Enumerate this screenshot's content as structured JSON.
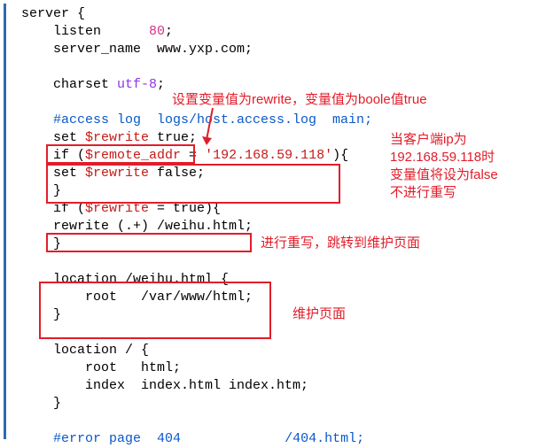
{
  "code": {
    "l1a": "server {",
    "l2a": "    listen      ",
    "l2b": "80",
    "l2c": ";",
    "l3a": "    server_name  www.yxp.com;",
    "l5a": "    charset ",
    "l5b": "utf-8",
    "l5c": ";",
    "l7a": "    #access log  logs/host.access.log  main;",
    "l8a": "    set ",
    "l8b": "$rewrite",
    "l8c": " true;",
    "l9a": "    if (",
    "l9b": "$remote_addr",
    "l9c": " = ",
    "l9d": "'192.168.59.118'",
    "l9e": "){",
    "l10a": "    set ",
    "l10b": "$rewrite",
    "l10c": " false;",
    "l11a": "    }",
    "l12a": "    if (",
    "l12b": "$rewrite",
    "l12c": " = true){",
    "l13a": "    rewrite (.+) /weihu.html;",
    "l14a": "    }",
    "l16a": "    location /weihu.html {",
    "l17a": "        root   /var/www/html;",
    "l18a": "    }",
    "l20a": "    location / {",
    "l21a": "        root   html;",
    "l22a": "        index  index.html index.htm;",
    "l23a": "    }",
    "l25a": "    #error page  ",
    "l25b": "404",
    "l25c": "             /",
    "l25d": "404",
    "l25e": ".html;"
  },
  "annotations": {
    "a1": "设置变量值为rewrite，变量值为boole值true",
    "a2": "当客户端ip为\n192.168.59.118时\n变量值将设为false\n不进行重写",
    "a3": "进行重写，跳转到维护页面",
    "a4": "维护页面"
  }
}
